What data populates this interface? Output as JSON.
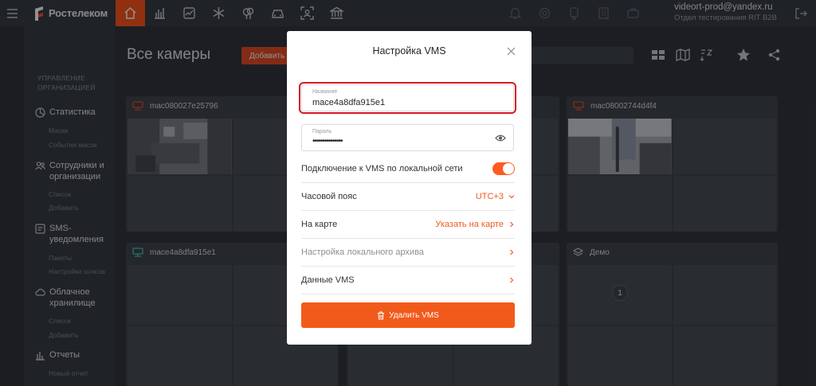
{
  "brand": {
    "name": "Ростелеком",
    "accent": "#ff4f12"
  },
  "topnav": {
    "items": [
      "home-icon",
      "stats-icon",
      "chart-icon",
      "snowflake-icon",
      "tree-icon",
      "car-icon",
      "face-scan-icon",
      "bank-icon"
    ],
    "right_icons": [
      "bell-icon",
      "support-icon",
      "badge-icon",
      "building-icon",
      "briefcase-icon"
    ]
  },
  "user": {
    "email": "videort-prod@yandex.ru",
    "department": "Отдел тестирования RIT B2B"
  },
  "sidebar": {
    "heading_line1": "Управление",
    "heading_line2": "организацией",
    "sections": [
      {
        "label_line1": "Статистика",
        "label_line2": "",
        "icon": "pie-chart-icon",
        "subs": [
          "Маски",
          "События масок"
        ]
      },
      {
        "label_line1": "Сотрудники и",
        "label_line2": "организации",
        "icon": "users-icon",
        "subs": [
          "Список",
          "Добавить"
        ]
      },
      {
        "label_line1": "SMS-",
        "label_line2": "уведомления",
        "icon": "sms-icon",
        "subs": [
          "Пакеты",
          "Настройки шлюза"
        ]
      },
      {
        "label_line1": "Облачное",
        "label_line2": "хранилище",
        "icon": "cloud-icon",
        "subs": [
          "Список",
          "Добавить"
        ]
      },
      {
        "label_line1": "Отчеты",
        "label_line2": "",
        "icon": "bar-chart-icon",
        "subs": [
          "Новый отчет"
        ]
      }
    ]
  },
  "main": {
    "title": "Все камеры",
    "add_button": "Добавить",
    "cards": [
      {
        "name": "mac080027e25796",
        "icon": "recorder-icon"
      },
      {
        "name": "mac08002744d4f4",
        "icon": "recorder-icon"
      },
      {
        "name": "mace4a8dfa915e1",
        "icon": "recorder-icon"
      },
      {
        "name": "Демо",
        "icon": "layers-icon",
        "badge": "1"
      }
    ]
  },
  "modal": {
    "title": "Настройка VMS",
    "name_label": "Название",
    "name_value": "mace4a8dfa915e1",
    "password_label": "Пароль",
    "password_value": "•••••••••••••••",
    "local_network_label": "Подключение к VMS по локальной сети",
    "local_network_on": true,
    "timezone_label": "Часовой пояс",
    "timezone_value": "UTC+3",
    "map_label": "На карте",
    "map_value": "Указать на карте",
    "archive_label": "Настройка локального архива",
    "vms_data_label": "Данные VMS",
    "delete_label": "Удалить VMS"
  }
}
